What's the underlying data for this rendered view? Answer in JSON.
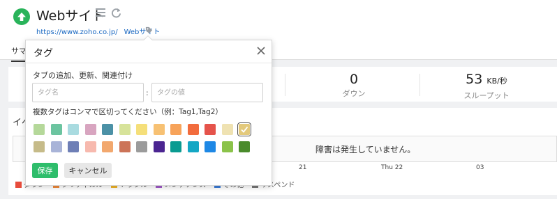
{
  "header": {
    "title": "Webサイト",
    "status_color": "#29b35a",
    "links": [
      "https://www.zoho.co.jp/",
      "Webサイト"
    ],
    "icons": {
      "status": "arrow-up-icon",
      "menu": "hamburger-icon",
      "refresh": "refresh-icon",
      "tag": "tag-icon"
    }
  },
  "tabs": {
    "summary": "サマリー"
  },
  "stats": [
    {
      "value": "0",
      "unit": "",
      "label": "ダウン"
    },
    {
      "value": "53",
      "unit": "KB/秒",
      "label": "スループット"
    }
  ],
  "events": {
    "heading": "イベント",
    "no_outage": "障害は発生していません。",
    "axis_ticks": [
      "21",
      "Thu 22",
      "03"
    ],
    "legend": [
      {
        "label": "ダウン",
        "color": "#e74c3c"
      },
      {
        "label": "クリティカル",
        "color": "#f08a3a"
      },
      {
        "label": "トラブル",
        "color": "#f0b429"
      },
      {
        "label": "メンテナンス",
        "color": "#a05ac8"
      },
      {
        "label": "その他",
        "color": "#3b7dd8"
      },
      {
        "label": "サスペンド",
        "color": "#777777"
      }
    ]
  },
  "popup": {
    "title": "タグ",
    "subtitle": "タブの追加、更新、関連付け",
    "name_placeholder": "タグ名",
    "value_placeholder": "タグの値",
    "separator": ":",
    "hint": "複数タグはコンマで区切ってください（例：Tag1,Tag2）",
    "save_label": "保存",
    "cancel_label": "キャンセル",
    "selected_swatch_index": 12,
    "swatch_colors": [
      "#b5d89a",
      "#6cc4a0",
      "#a9dbe0",
      "#d8a5c0",
      "#4c91a6",
      "#d7e39a",
      "#f5df7a",
      "#f7c173",
      "#f7a35a",
      "#f26c3d",
      "#e5534b",
      "#efe2b2",
      "#e3c97b",
      "#c6bb89",
      "#a9b4d8",
      "#6e7fb6",
      "#f7b9ae",
      "#f2a86e",
      "#cc7458",
      "#9b9b9b",
      "#4b2591",
      "#0a9b91",
      "#14a7c4",
      "#1e88e5",
      "#8bc34a",
      "#4a8b2c"
    ]
  }
}
